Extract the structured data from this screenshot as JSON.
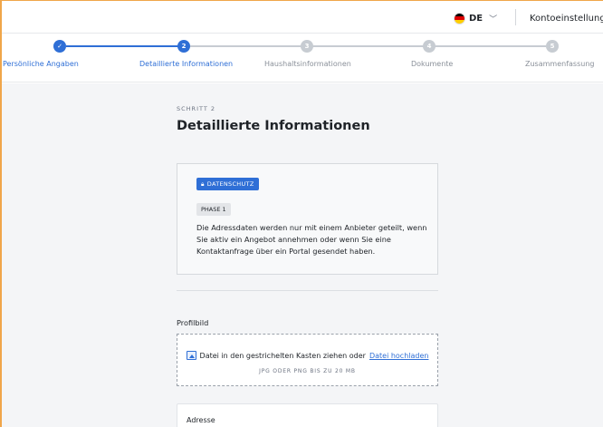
{
  "header": {
    "language": "DE",
    "account_label": "Kontoeinstellung",
    "flag_colors": [
      "#000000",
      "#dd0000",
      "#ffce00"
    ]
  },
  "stepper": {
    "colors": {
      "active": "#2f6fd6",
      "inactive": "#c7ccd2",
      "done_label": "#2f6fd6",
      "inactive_label": "#8a9099"
    },
    "steps": [
      {
        "label": "Persönliche Angaben",
        "number": "✓",
        "state": "done"
      },
      {
        "label": "Detaillierte Informationen",
        "number": "2",
        "state": "active"
      },
      {
        "label": "Haushaltsinformationen",
        "number": "3",
        "state": "pending"
      },
      {
        "label": "Dokumente",
        "number": "4",
        "state": "pending"
      },
      {
        "label": "Zusammenfassung",
        "number": "5",
        "state": "pending"
      }
    ]
  },
  "main": {
    "eyebrow": "SCHRITT 2",
    "title": "Detaillierte Informationen",
    "privacy": {
      "badge": "DATENSCHUTZ",
      "phase": "PHASE 1",
      "text": "Die Adressdaten werden nur mit einem Anbieter geteilt, wenn Sie aktiv ein Angebot annehmen oder wenn Sie eine Kontaktanfrage über ein Portal gesendet haben."
    },
    "profile": {
      "label": "Profilbild",
      "drop_text": "Datei in den gestrichelten Kasten ziehen oder",
      "upload_link": "Datei hochladen",
      "hint": "JPG ODER PNG BIS ZU 20 MB"
    },
    "address": {
      "label": "Adresse"
    }
  }
}
